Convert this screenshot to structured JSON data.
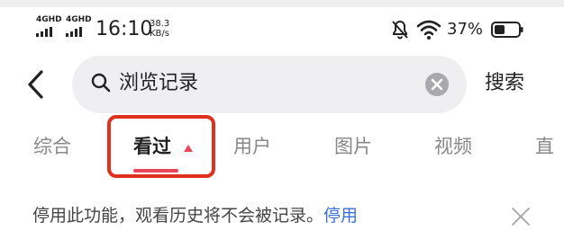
{
  "status_bar": {
    "network_1": "4GHD",
    "network_2": "4GHD",
    "time": "16:10",
    "speed_value": "38.3",
    "speed_unit": "KB/s",
    "battery_percent": "37%",
    "icons": [
      "signal-icon",
      "signal-icon",
      "mute-icon",
      "wifi-icon",
      "battery-icon"
    ]
  },
  "search": {
    "value": "浏览记录",
    "button_label": "搜索",
    "icons": [
      "back-arrow-icon",
      "search-icon",
      "clear-icon"
    ]
  },
  "tabs": [
    {
      "label": "综合",
      "active": false
    },
    {
      "label": "看过",
      "active": true
    },
    {
      "label": "用户",
      "active": false
    },
    {
      "label": "图片",
      "active": false
    },
    {
      "label": "视频",
      "active": false
    },
    {
      "label": "直",
      "active": false
    }
  ],
  "notice": {
    "text": "停用此功能，观看历史将不会被记录。",
    "link_label": "停用"
  },
  "colors": {
    "accent": "#e8475a",
    "highlight_box": "#e0301e",
    "link": "#3a6fd8",
    "search_bg": "#efeff1"
  }
}
